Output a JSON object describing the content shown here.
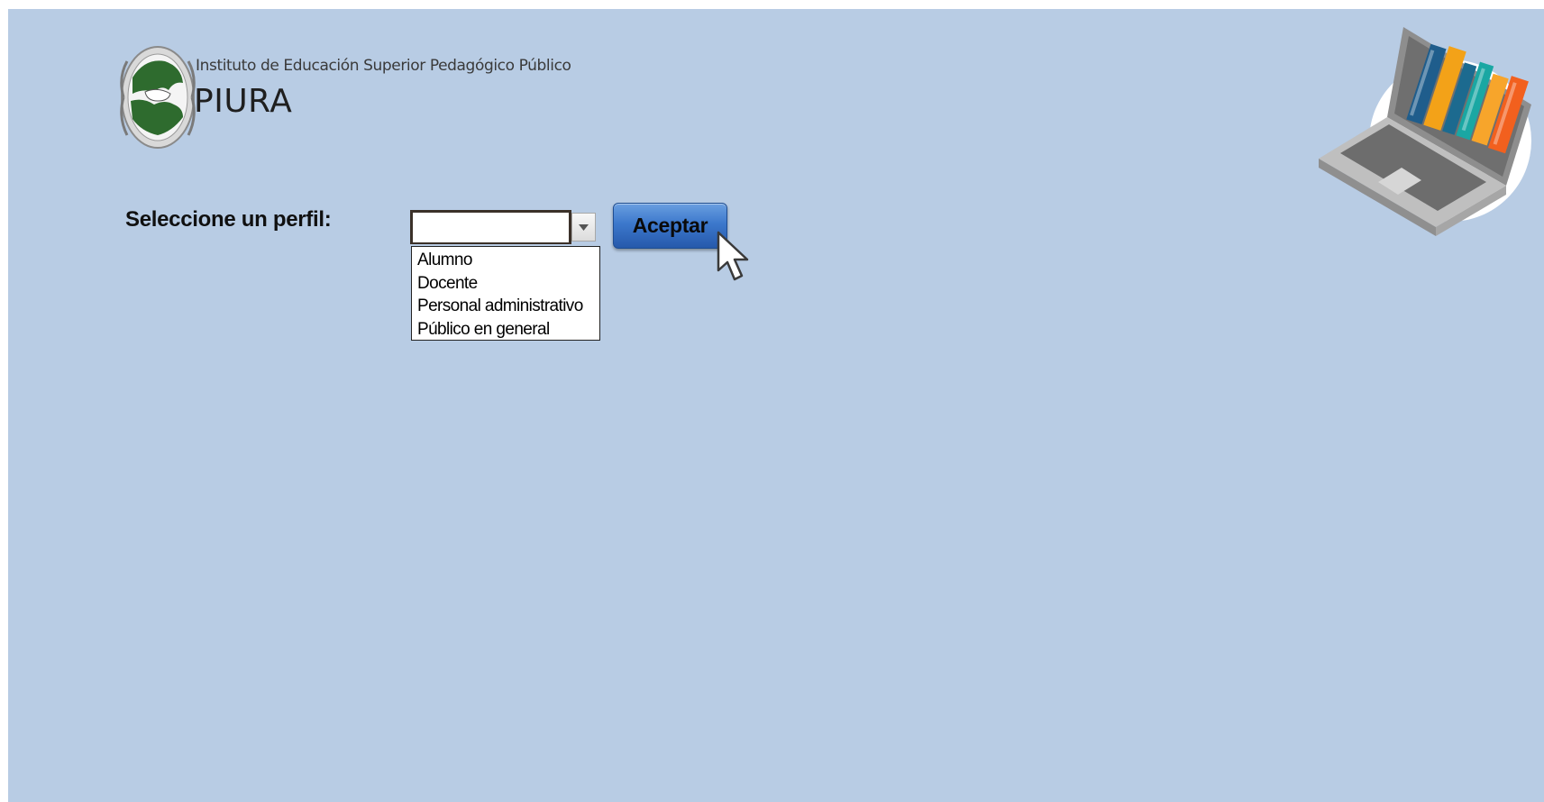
{
  "header": {
    "institution_name": "Instituto de Educación Superior Pedagógico Público",
    "city": "PIURA",
    "seal_icon": "institution-seal-icon",
    "hero_icon": "laptop-books-icon"
  },
  "form": {
    "profile_label": "Seleccione un perfil:",
    "profile_select": {
      "value": "",
      "expanded": true,
      "options": [
        "Alumno",
        "Docente",
        "Personal administrativo",
        "Público en general"
      ]
    },
    "accept_label": "Aceptar"
  },
  "colors": {
    "background": "#b8cce4",
    "button": "#3c78cc"
  }
}
